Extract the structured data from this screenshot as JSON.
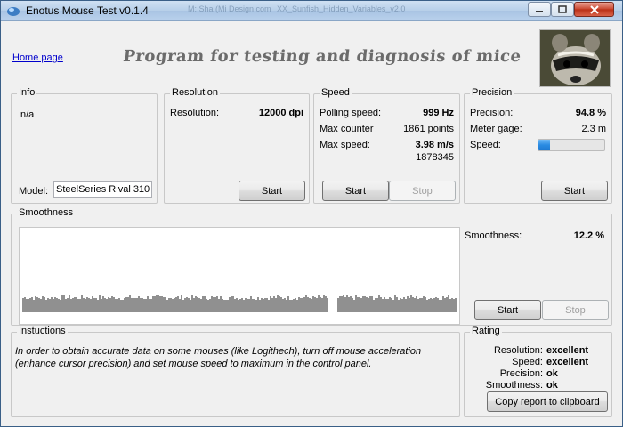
{
  "window": {
    "title": "Enotus Mouse Test v0.1.4",
    "background_ghost_text": [
      "M: Sha (Mi Design com",
      "XX_Sunfish_Hidden_Variables_v2.0"
    ]
  },
  "header": {
    "home_link": "Home page",
    "banner": "Program for testing and diagnosis of mice"
  },
  "info": {
    "label": "Info",
    "status": "n/a",
    "model_label": "Model:",
    "model_value": "SteelSeries Rival 310"
  },
  "resolution": {
    "label": "Resolution",
    "key": "Resolution:",
    "value": "12000 dpi",
    "start": "Start"
  },
  "speed": {
    "label": "Speed",
    "polling_key": "Polling speed:",
    "polling_value": "999 Hz",
    "counter_key": "Max counter",
    "counter_value": "1861 points",
    "maxspeed_key": "Max  speed:",
    "maxspeed_value": "3.98 m/s",
    "maxspeed_sub": "1878345",
    "start": "Start",
    "stop": "Stop"
  },
  "precision": {
    "label": "Precision",
    "precision_key": "Precision:",
    "precision_value": "94.8 %",
    "gage_key": "Meter gage:",
    "gage_value": "2.3 m",
    "speed_key": "Speed:",
    "speed_level": 0.17,
    "start": "Start"
  },
  "smoothness": {
    "label": "Smoothness",
    "key": "Smoothness:",
    "value": "12.2 %",
    "start": "Start",
    "stop": "Stop"
  },
  "instructions": {
    "label": "Instuctions",
    "text": "In order to obtain accurate data on some mouses (like Logithech), turn off mouse acceleration (enhance cursor precision) and set mouse speed to maximum in the control panel."
  },
  "rating": {
    "label": "Rating",
    "items": [
      {
        "key": "Resolution:",
        "value": "excellent"
      },
      {
        "key": "Speed:",
        "value": "excellent"
      },
      {
        "key": "Precision:",
        "value": "ok"
      },
      {
        "key": "Smoothness:",
        "value": "ok"
      }
    ],
    "copy_button": "Copy report to clipboard"
  }
}
